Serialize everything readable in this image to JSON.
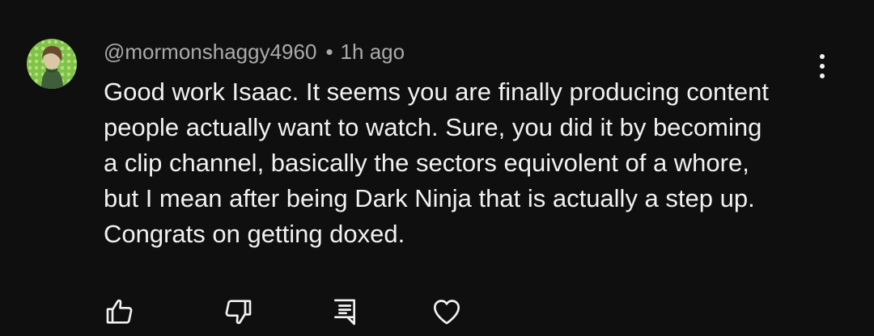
{
  "comment": {
    "author": "@mormonshaggy4960",
    "separator": "•",
    "timestamp": "1h ago",
    "text_lines": [
      "Good work Isaac. It seems you are finally producing content",
      "people actually want to watch. Sure, you did it by becoming",
      "a clip channel, basically the sectors equivolent of a whore,",
      "but I mean after being Dark Ninja that is actually a step up.",
      "Congrats on getting doxed."
    ]
  },
  "icons": {
    "avatar": "avatar-image",
    "menu": "more-vertical-icon",
    "like": "thumb-up-icon",
    "dislike": "thumb-down-icon",
    "reply": "reply-comment-icon",
    "heart": "heart-icon"
  },
  "colors": {
    "background": "#0f0f0f",
    "text_primary": "#f1f1f1",
    "text_secondary": "#aaaaaa",
    "avatar_green": "#7bc043"
  }
}
